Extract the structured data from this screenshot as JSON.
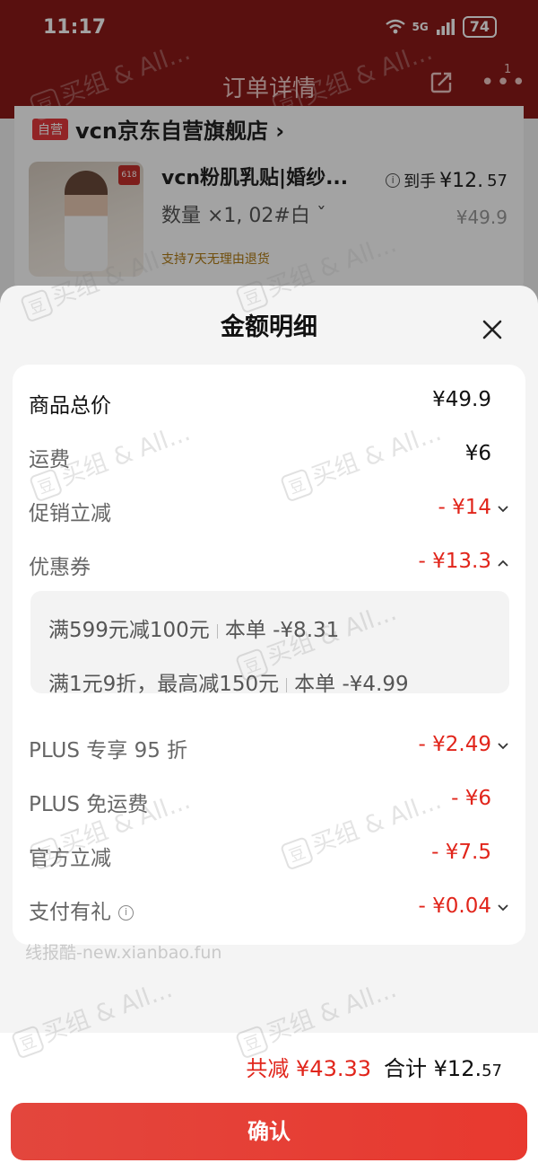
{
  "status_bar": {
    "time": "11:17",
    "network": "5G",
    "battery": "74"
  },
  "nav": {
    "title": "订单详情",
    "more_badge": "1"
  },
  "store": {
    "tag": "自营",
    "name": "vcn京东自营旗舰店 ›"
  },
  "product": {
    "title": "vcn粉肌乳贴|婚纱...",
    "spec": "数量 ×1, 02#白 ˇ",
    "final_price_label": "到手",
    "final_price": "¥12.",
    "final_price_cents": "57",
    "original_price": "¥49.9",
    "return_note": "支持7天无理由退货",
    "thumb_badge": "618"
  },
  "sheet": {
    "title": "金额明细",
    "rows": [
      {
        "label": "商品总价",
        "amount": "¥49.9"
      },
      {
        "label": "运费",
        "amount": "¥6"
      },
      {
        "label": "促销立减",
        "amount": "- ¥14"
      },
      {
        "label": "优惠券",
        "amount": "- ¥13.3"
      },
      {
        "label": "PLUS 专享 95 折",
        "amount": "- ¥2.49"
      },
      {
        "label": "PLUS 免运费",
        "amount": "- ¥6"
      },
      {
        "label": "官方立减",
        "amount": "- ¥7.5"
      },
      {
        "label": "支付有礼",
        "amount": "- ¥0.04"
      }
    ],
    "coupons": [
      {
        "name": "满599元减100元",
        "value": "本单 -¥8.31"
      },
      {
        "name": "满1元9折，最高减150元",
        "value": "本单 -¥4.99"
      }
    ]
  },
  "footer": {
    "total_saved": "共减 ¥43.33",
    "total_label": "合计",
    "total_main": "¥12.",
    "total_cents": "57",
    "confirm_label": "确认"
  },
  "source_watermark": "线报酷-new.xianbao.fun",
  "watermark_text": "买组 & All...",
  "watermark_badge": "豆",
  "colors": {
    "accent_red": "#e1251b",
    "header_red": "#8b1a18",
    "button_red": "#e63f36"
  }
}
